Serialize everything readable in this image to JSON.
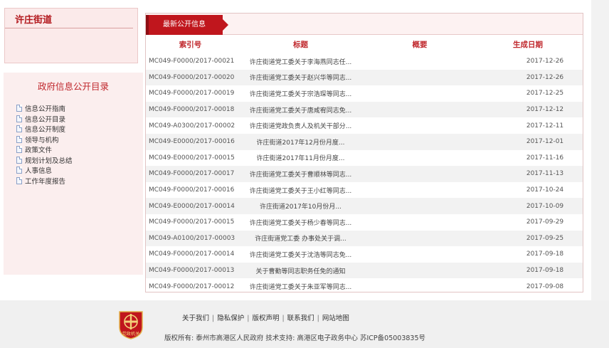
{
  "sidebar": {
    "org_name": "许庄街道",
    "catalog_title": "政府信息公开目录",
    "items": [
      {
        "label": "信息公开指南"
      },
      {
        "label": "信息公开目录"
      },
      {
        "label": "信息公开制度"
      },
      {
        "label": "领导与机构"
      },
      {
        "label": "政策文件"
      },
      {
        "label": "规划计划及总结"
      },
      {
        "label": "人事信息"
      },
      {
        "label": "工作年度报告"
      }
    ]
  },
  "panel": {
    "tab_label": "最新公开信息",
    "columns": {
      "index": "索引号",
      "title": "标题",
      "summary": "概要",
      "date": "生成日期"
    },
    "rows": [
      {
        "index": "MC049-F0000/2017-00021",
        "title": "许庄街道党工委关于李海燕同志任...",
        "date": "2017-12-26"
      },
      {
        "index": "MC049-F0000/2017-00020",
        "title": "许庄街道党工委关于赵兴华等同志...",
        "date": "2017-12-26"
      },
      {
        "index": "MC049-F0000/2017-00019",
        "title": "许庄街道党工委关于宗浩琛等同志...",
        "date": "2017-12-25"
      },
      {
        "index": "MC049-F0000/2017-00018",
        "title": "许庄街道党工委关于唐咸宥同志免...",
        "date": "2017-12-12"
      },
      {
        "index": "MC049-A0300/2017-00002",
        "title": "许庄街道党政负责人及机关干部分...",
        "date": "2017-12-11"
      },
      {
        "index": "MC049-E0000/2017-00016",
        "title": "许庄街道2017年12月份月度...",
        "date": "2017-12-01"
      },
      {
        "index": "MC049-E0000/2017-00015",
        "title": "许庄街道2017年11月份月度...",
        "date": "2017-11-16"
      },
      {
        "index": "MC049-F0000/2017-00017",
        "title": "许庄街道党工委关于曹顺林等同志...",
        "date": "2017-11-13"
      },
      {
        "index": "MC049-F0000/2017-00016",
        "title": "许庄街道党工委关于王小红等同志...",
        "date": "2017-10-24"
      },
      {
        "index": "MC049-E0000/2017-00014",
        "title": "许庄街道2017年10月份月...",
        "date": "2017-10-09"
      },
      {
        "index": "MC049-F0000/2017-00015",
        "title": "许庄街道党工委关于杨少春等同志...",
        "date": "2017-09-29"
      },
      {
        "index": "MC049-A0100/2017-00003",
        "title": "许庄街道党工委 办事处关于调...",
        "date": "2017-09-25"
      },
      {
        "index": "MC049-F0000/2017-00014",
        "title": "许庄街道党工委关于沈浩等同志免...",
        "date": "2017-09-18"
      },
      {
        "index": "MC049-F0000/2017-00013",
        "title": "关于曹勤等同志职务任免的通知",
        "date": "2017-09-18"
      },
      {
        "index": "MC049-F0000/2017-00012",
        "title": "许庄街道党工委关于朱亚军等同志...",
        "date": "2017-09-08"
      }
    ]
  },
  "footer": {
    "emblem_text": "党政机关",
    "links": [
      "关于我们",
      "隐私保护",
      "版权声明",
      "联系我们",
      "网站地图"
    ],
    "copyright": "版权所有: 泰州市高港区人民政府 技术支持: 高港区电子政务中心 苏ICP备05003835号"
  },
  "colors": {
    "accent": "#c0161d",
    "panel_head_bg": "#fdf2f2",
    "sidebar_bg": "#fbeeee",
    "footer_bg": "#f0f0f0"
  }
}
